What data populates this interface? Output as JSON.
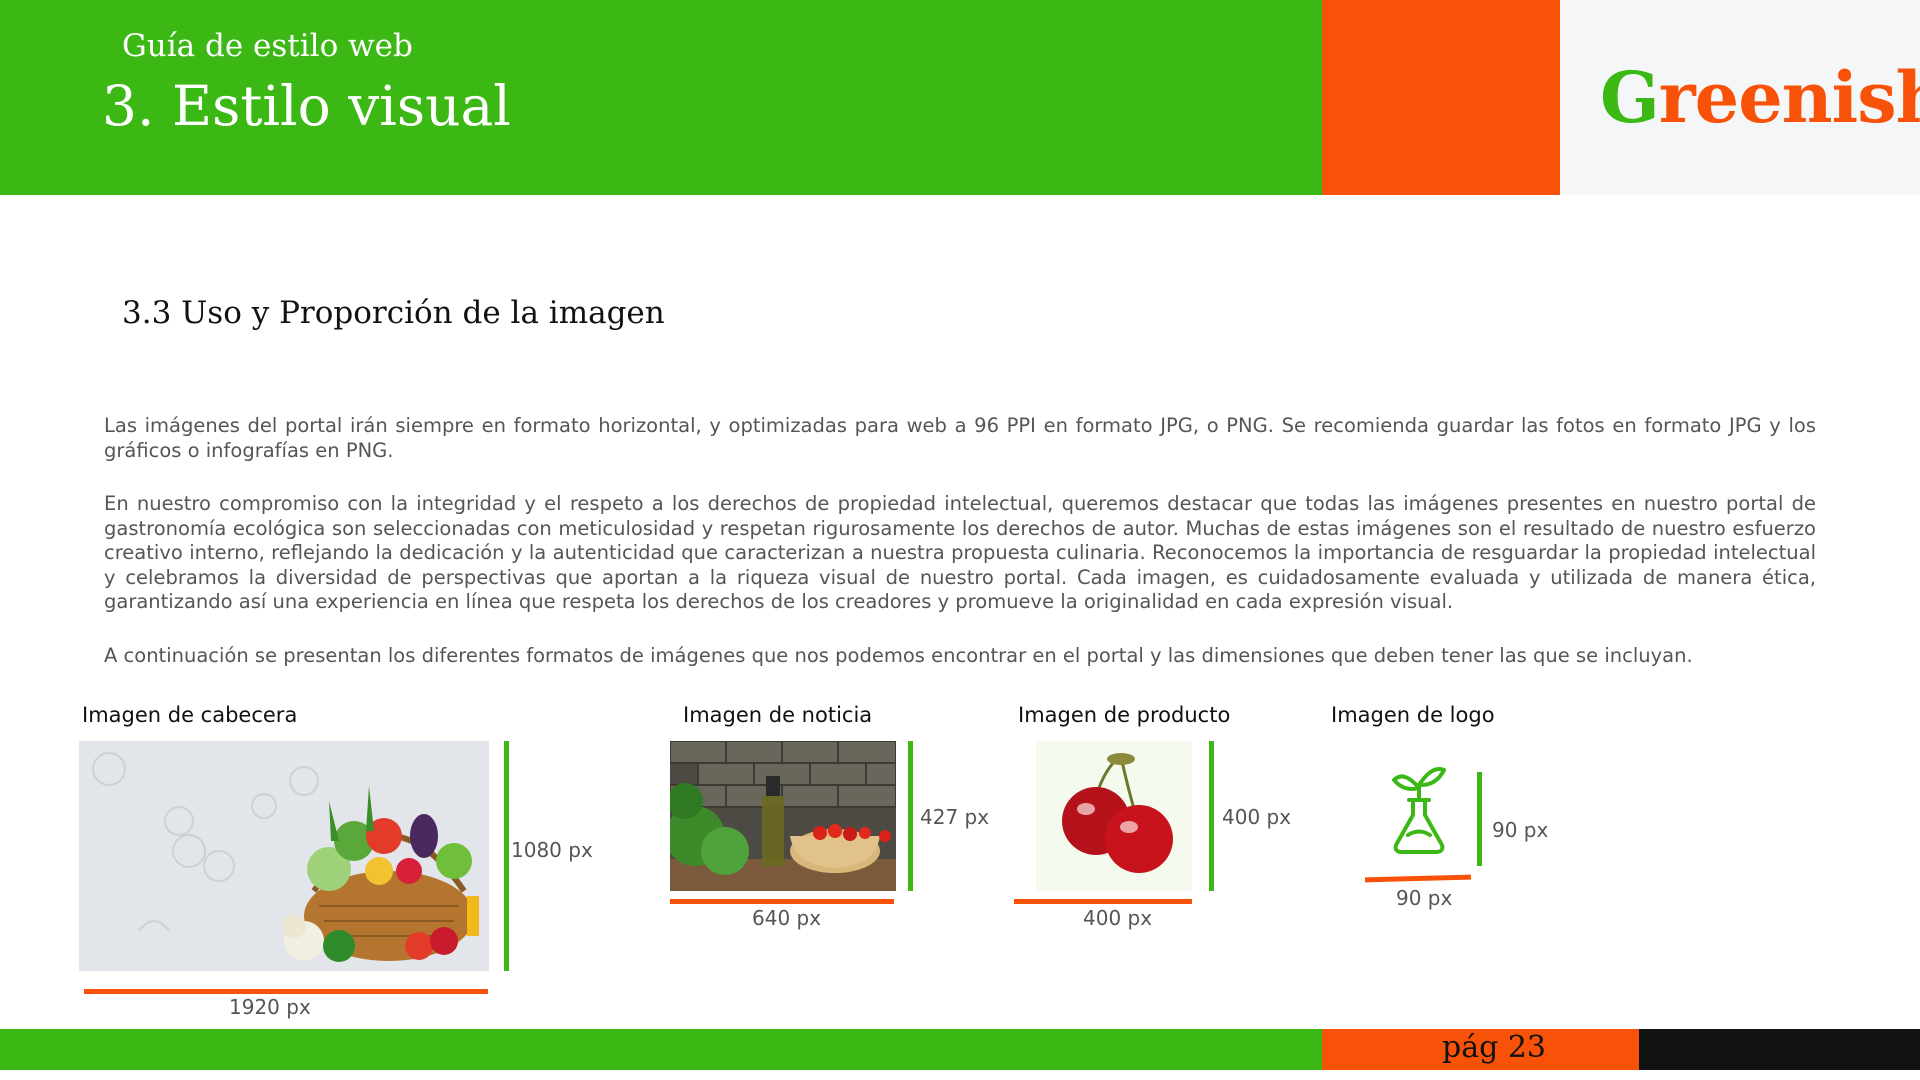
{
  "header": {
    "kicker": "Guía de estilo web",
    "title": "3. Estilo visual",
    "brand_part1": "G",
    "brand_part2": "reenish",
    "colors": {
      "green": "#3cb815",
      "orange": "#f75208",
      "light": "#f5f6f8"
    }
  },
  "section": {
    "title": "3.3 Uso y Proporción de la imagen",
    "paragraphs": [
      "Las imágenes del portal irán siempre en formato horizontal, y optimizadas para web a 96 PPI en formato JPG, o PNG. Se recomienda guardar las fotos en formato JPG y los gráficos o infografías en PNG.",
      "En nuestro compromiso con la integridad y el respeto a los derechos de propiedad intelectual, queremos destacar que todas las imágenes presentes en nuestro portal de gastronomía ecológica son seleccionadas con meticulosidad y respetan rigurosamente los derechos de autor. Muchas de estas imágenes son el resultado de nuestro esfuerzo creativo interno, reflejando la dedicación y la autenticidad que caracterizan a nuestra propuesta culinaria. Reconocemos la importancia de resguardar la propiedad intelectual y celebramos la diversidad de perspectivas que aportan a la riqueza visual de nuestro portal. Cada imagen, es cuidadosamente evaluada y utilizada de manera ética, garantizando así una experiencia en línea que respeta los derechos de los creadores y promueve la originalidad en cada expresión visual.",
      "A continuación se presentan los diferentes formatos de imágenes que nos podemos encontrar en el portal y las dimensiones que deben tener las que se incluyan."
    ]
  },
  "figures": [
    {
      "label": "Imagen de cabecera",
      "height_label": "1080 px",
      "width_label": "1920 px",
      "icon": "vegetable-basket-photo"
    },
    {
      "label": "Imagen de noticia",
      "height_label": "427 px",
      "width_label": "640 px",
      "icon": "oil-tomatoes-photo"
    },
    {
      "label": "Imagen de producto",
      "height_label": "400 px",
      "width_label": "400 px",
      "icon": "cherries-photo"
    },
    {
      "label": "Imagen de logo",
      "height_label": "90 px",
      "width_label": "90 px",
      "icon": "plant-flask-icon"
    }
  ],
  "footer": {
    "page": "pág 23"
  }
}
